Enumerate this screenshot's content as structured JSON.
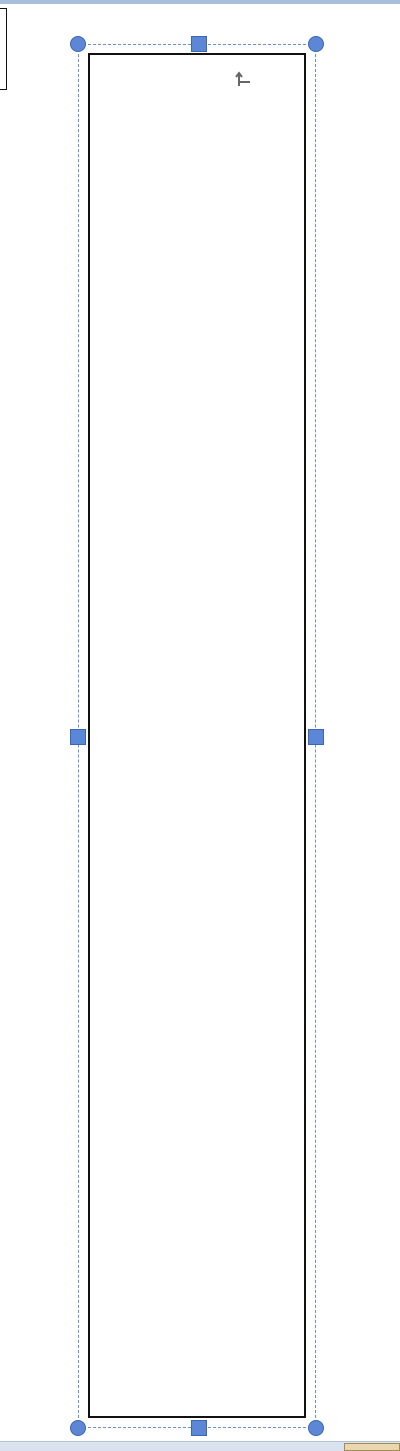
{
  "document": {
    "shape": "text-box",
    "selected": true,
    "anchor_icon": "anchor-icon"
  },
  "handles": [
    {
      "name": "handle-top-left",
      "shape": "circle"
    },
    {
      "name": "handle-top-middle",
      "shape": "square"
    },
    {
      "name": "handle-top-right",
      "shape": "circle"
    },
    {
      "name": "handle-middle-left",
      "shape": "square"
    },
    {
      "name": "handle-middle-right",
      "shape": "square"
    },
    {
      "name": "handle-bottom-left",
      "shape": "circle"
    },
    {
      "name": "handle-bottom-middle",
      "shape": "square"
    },
    {
      "name": "handle-bottom-right",
      "shape": "circle"
    }
  ],
  "colors": {
    "handle": "#5b87d6",
    "selection": "#6b8fd0",
    "border": "#111111"
  }
}
